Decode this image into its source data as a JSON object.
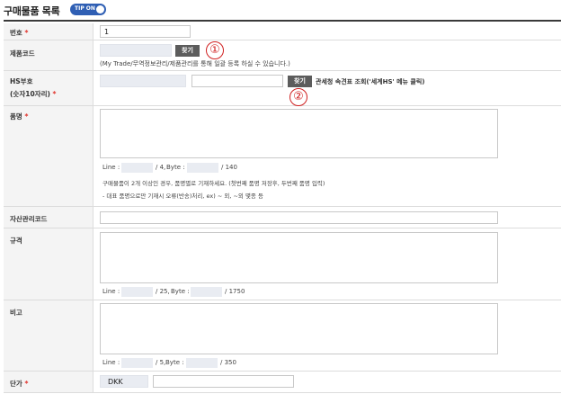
{
  "header": {
    "title": "구매물품 목록",
    "toggle_label": "TIP ON"
  },
  "rows": {
    "number": {
      "label": "번호",
      "req": "*",
      "value": "1"
    },
    "product_code": {
      "label": "제품코드",
      "find": "찾기",
      "note": "(My Trade/무역정보관리/제품관리를 통해 일괄 등록 하실 수 있습니다.)",
      "marker": "①"
    },
    "hs_code": {
      "label1": "HS부호",
      "label2": "(숫자10자리)",
      "req": "*",
      "find": "찾기",
      "link": "관세청 속견표 조회('세계HS' 메뉴 클릭)",
      "marker": "②"
    },
    "item_name": {
      "label": "품명",
      "req": "*",
      "line_label": "Line :",
      "line_max": "/ 4,",
      "byte_label": "Byte :",
      "byte_max": "/ 140",
      "guide1": "구매물품이 2개 이상인 경우, 품명별로 기재하세요. (첫번째 품명 저장후, 두번째 품명 입력)",
      "guide2": "- 대표 품명으로만 기재시 오류(반송)처리, ex) ~ 외, ~외 몇종 등"
    },
    "asset_code": {
      "label": "자산관리코드"
    },
    "spec": {
      "label": "규격",
      "line_label": "Line :",
      "line_max": "/ 25,",
      "byte_label": "Byte :",
      "byte_max": "/ 1750"
    },
    "remark": {
      "label": "비고",
      "line_label": "Line :",
      "line_max": "/ 5,",
      "byte_label": "Byte :",
      "byte_max": "/ 350"
    },
    "unit_price": {
      "label": "단가",
      "req": "*",
      "currency": "DKK"
    }
  },
  "colors": {
    "toggle": "#2f5fb4",
    "button": "#5c5c5c",
    "required": "#e0322b",
    "marker": "#d02020"
  }
}
